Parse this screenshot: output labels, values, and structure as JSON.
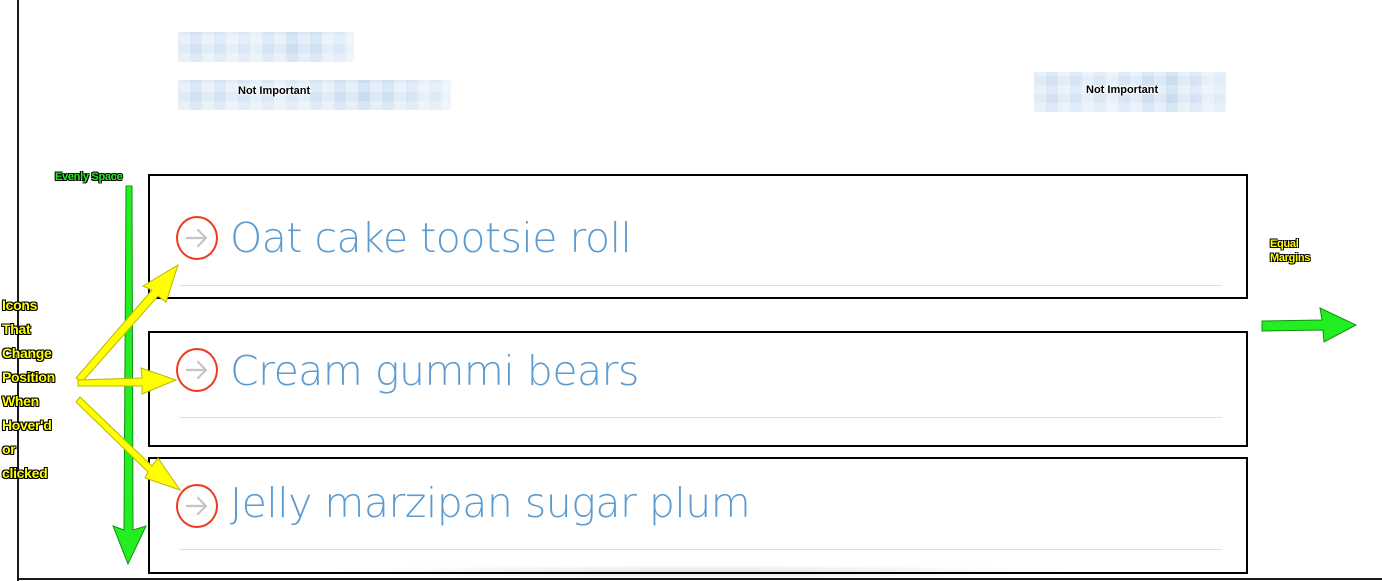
{
  "header": {
    "left_placeholder": "Not Important",
    "right_placeholder": "Not Important"
  },
  "list": {
    "items": [
      {
        "label": "Oat cake tootsie roll",
        "icon": "arrow-right-icon"
      },
      {
        "label": "Cream gummi bears",
        "icon": "arrow-right-icon"
      },
      {
        "label": "Jelly marzipan sugar plum",
        "icon": "arrow-right-icon"
      }
    ]
  },
  "annotations": {
    "evenly_space": "Evenly Space",
    "equal_margins": "Equal\nMargins",
    "icons_note": "Icons\nThat\nChange\nPosition\nWhen\nHover'd\nor\nclicked"
  },
  "colors": {
    "item_text": "#5b9bd0",
    "icon_ring": "#ee3a1e",
    "icon_arrow": "#c4c4c4",
    "annotation_yellow": "#ffff00",
    "annotation_green": "#22ee22"
  }
}
